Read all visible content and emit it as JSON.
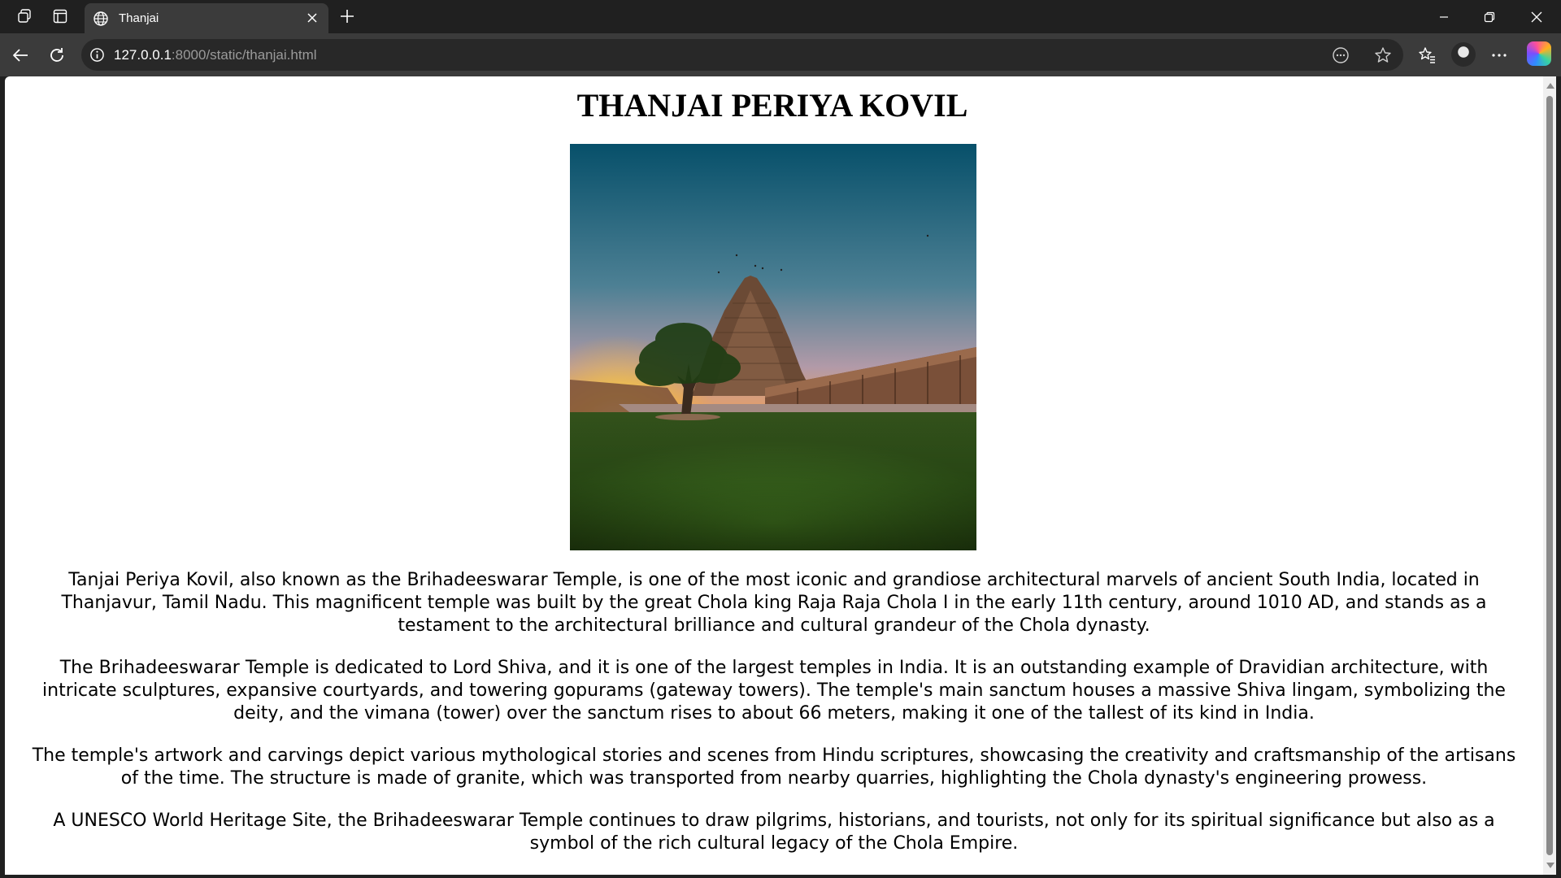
{
  "browser": {
    "tab": {
      "title": "Thanjai"
    },
    "address": {
      "host": "127.0.0.1",
      "rest": ":8000/static/thanjai.html"
    }
  },
  "page": {
    "heading": "THANJAI PERIYA KOVIL",
    "paragraphs": [
      "Tanjai Periya Kovil, also known as the Brihadeeswarar Temple, is one of the most iconic and grandiose architectural marvels of ancient South India, located in Thanjavur, Tamil Nadu. This magnificent temple was built by the great Chola king Raja Raja Chola I in the early 11th century, around 1010 AD, and stands as a testament to the architectural brilliance and cultural grandeur of the Chola dynasty.",
      "The Brihadeeswarar Temple is dedicated to Lord Shiva, and it is one of the largest temples in India. It is an outstanding example of Dravidian architecture, with intricate sculptures, expansive courtyards, and towering gopurams (gateway towers). The temple's main sanctum houses a massive Shiva lingam, symbolizing the deity, and the vimana (tower) over the sanctum rises to about 66 meters, making it one of the tallest of its kind in India.",
      "The temple's artwork and carvings depict various mythological stories and scenes from Hindu scriptures, showcasing the creativity and craftsmanship of the artisans of the time. The structure is made of granite, which was transported from nearby quarries, highlighting the Chola dynasty's engineering prowess.",
      "A UNESCO World Heritage Site, the Brihadeeswarar Temple continues to draw pilgrims, historians, and tourists, not only for its spiritual significance but also as a symbol of the rich cultural legacy of the Chola Empire."
    ]
  }
}
